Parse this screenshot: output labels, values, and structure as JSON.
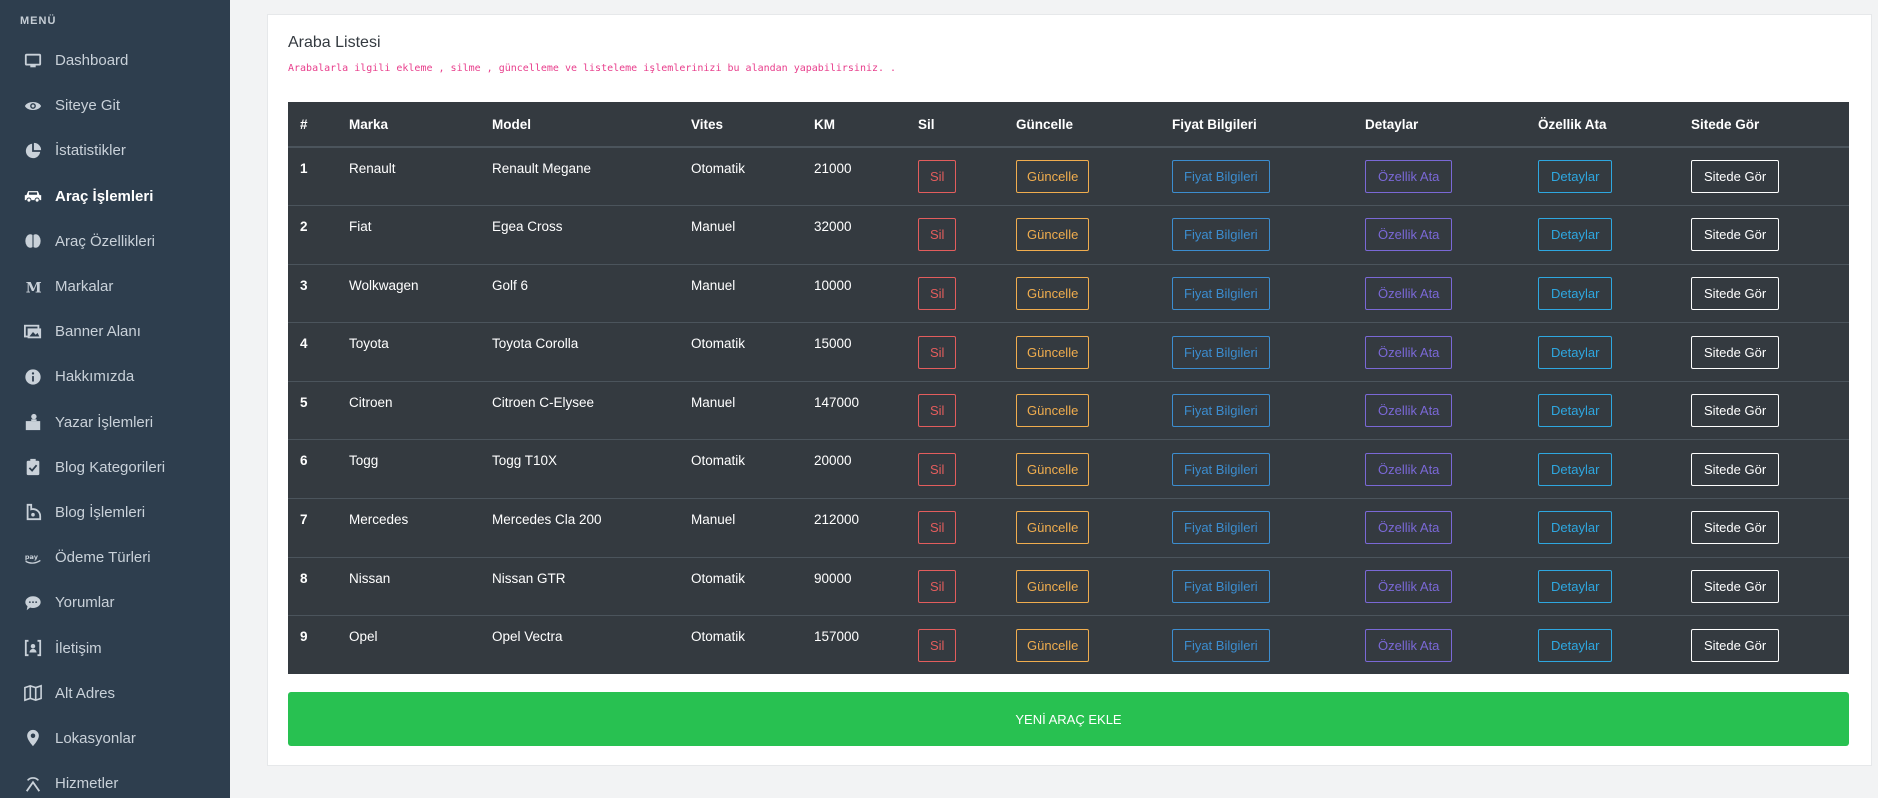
{
  "sidebar": {
    "heading": "MENÜ",
    "items": [
      {
        "label": "Dashboard",
        "icon": "monitor-icon"
      },
      {
        "label": "Siteye Git",
        "icon": "eye-icon"
      },
      {
        "label": "İstatistikler",
        "icon": "pie-chart-icon"
      },
      {
        "label": "Araç İşlemleri",
        "icon": "car-icon",
        "active": true
      },
      {
        "label": "Araç Özellikleri",
        "icon": "brain-icon"
      },
      {
        "label": "Markalar",
        "icon": "letter-m-icon"
      },
      {
        "label": "Banner Alanı",
        "icon": "images-icon"
      },
      {
        "label": "Hakkımızda",
        "icon": "info-icon"
      },
      {
        "label": "Yazar İşlemleri",
        "icon": "user-desk-icon"
      },
      {
        "label": "Blog Kategorileri",
        "icon": "clipboard-check-icon"
      },
      {
        "label": "Blog İşlemleri",
        "icon": "blogger-icon"
      },
      {
        "label": "Ödeme Türleri",
        "icon": "pay-icon"
      },
      {
        "label": "Yorumlar",
        "icon": "comment-icon"
      },
      {
        "label": "İletişim",
        "icon": "contact-bracket-icon"
      },
      {
        "label": "Alt Adres",
        "icon": "map-icon"
      },
      {
        "label": "Lokasyonlar",
        "icon": "location-pin-icon"
      },
      {
        "label": "Hizmetler",
        "icon": "broadcast-icon"
      }
    ]
  },
  "card": {
    "title": "Araba Listesi",
    "subtitle": "Arabalarla ilgili ekleme , silme , güncelleme ve listeleme işlemlerinizi bu alandan yapabilirsiniz. ."
  },
  "table": {
    "headers": [
      "#",
      "Marka",
      "Model",
      "Vites",
      "KM",
      "Sil",
      "Güncelle",
      "Fiyat Bilgileri",
      "Detaylar",
      "Özellik Ata",
      "Sitede Gör"
    ],
    "button_labels": {
      "sil": "Sil",
      "guncelle": "Güncelle",
      "fiyat": "Fiyat Bilgileri",
      "ozellik": "Özellik Ata",
      "detay": "Detaylar",
      "sitede": "Sitede Gör"
    },
    "rows": [
      {
        "no": "1",
        "marka": "Renault",
        "model": "Renault Megane",
        "vites": "Otomatik",
        "km": "21000"
      },
      {
        "no": "2",
        "marka": "Fiat",
        "model": "Egea Cross",
        "vites": "Manuel",
        "km": "32000"
      },
      {
        "no": "3",
        "marka": "Wolkwagen",
        "model": "Golf 6",
        "vites": "Manuel",
        "km": "10000"
      },
      {
        "no": "4",
        "marka": "Toyota",
        "model": "Toyota Corolla",
        "vites": "Otomatik",
        "km": "15000"
      },
      {
        "no": "5",
        "marka": "Citroen",
        "model": "Citroen C-Elysee",
        "vites": "Manuel",
        "km": "147000"
      },
      {
        "no": "6",
        "marka": "Togg",
        "model": "Togg T10X",
        "vites": "Otomatik",
        "km": "20000"
      },
      {
        "no": "7",
        "marka": "Mercedes",
        "model": "Mercedes Cla 200",
        "vites": "Manuel",
        "km": "212000"
      },
      {
        "no": "8",
        "marka": "Nissan",
        "model": "Nissan GTR",
        "vites": "Otomatik",
        "km": "90000"
      },
      {
        "no": "9",
        "marka": "Opel",
        "model": "Opel Vectra",
        "vites": "Otomatik",
        "km": "157000"
      }
    ]
  },
  "add_button": {
    "label": "YENİ ARAÇ EKLE"
  },
  "colors": {
    "sidebar_bg": "#2e3e4e",
    "table_bg": "#343a40",
    "danger": "#e35d5d",
    "warning": "#f0ad4e",
    "primary": "#3c8dcf",
    "purple": "#7a68d6",
    "info": "#2ea7e0",
    "success": "#28c151",
    "subtitle": "#e83e8c"
  }
}
